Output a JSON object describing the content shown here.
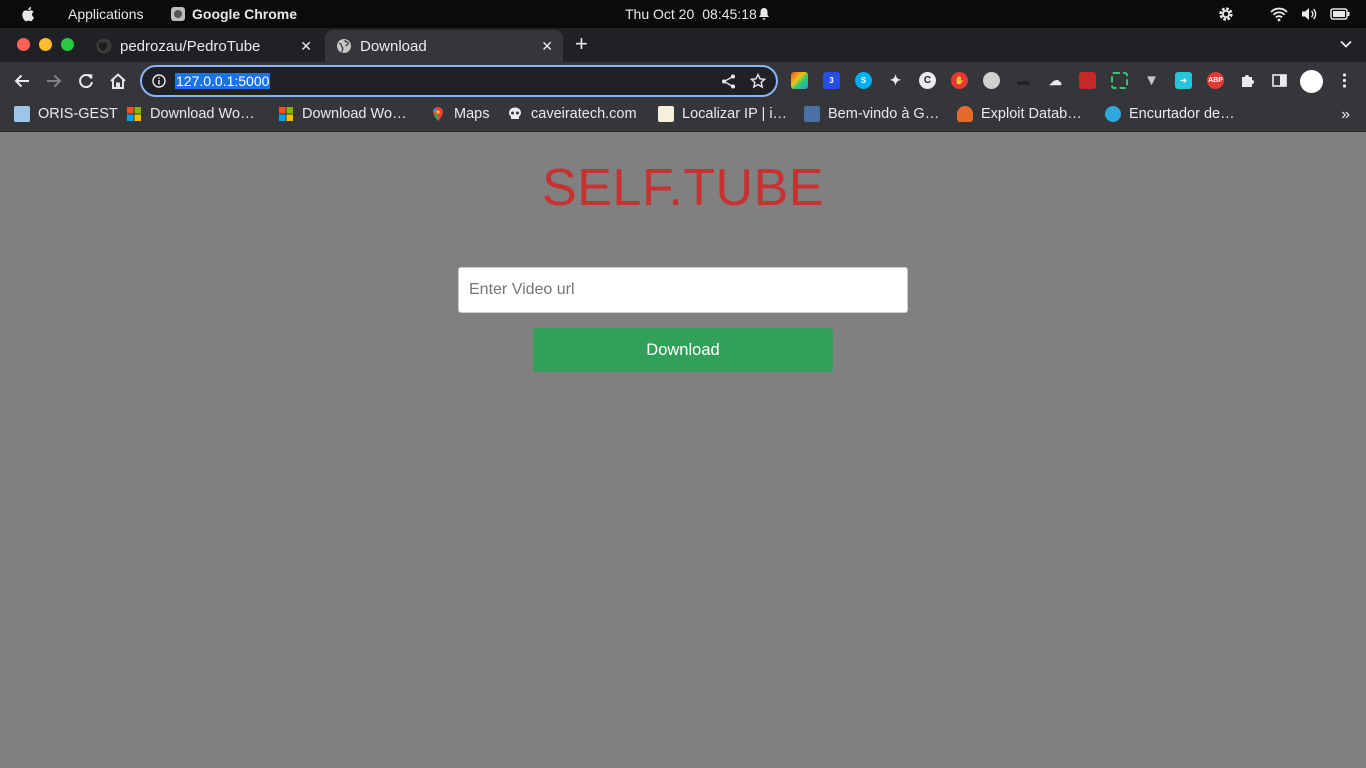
{
  "system_bar": {
    "applications_label": "Applications",
    "app_name": "Google Chrome",
    "date": "Thu Oct 20",
    "time": "08:45:18"
  },
  "browser": {
    "tabs": [
      {
        "title": "pedrozau/PedroTube",
        "icon": "github-icon",
        "active": false
      },
      {
        "title": "Download",
        "icon": "globe-icon",
        "active": true
      }
    ],
    "address": "127.0.0.1:5000",
    "bookmarks": [
      {
        "label": "ORIS-GEST",
        "icon": "book-icon"
      },
      {
        "label": "Download Wo…",
        "icon": "microsoft-icon"
      },
      {
        "label": "Download Wo…",
        "icon": "microsoft-icon"
      },
      {
        "label": "Maps",
        "icon": "maps-pin-icon"
      },
      {
        "label": "caveiratech.com",
        "icon": "skull-icon"
      },
      {
        "label": "Localizar IP | i…",
        "icon": "notepad-icon"
      },
      {
        "label": "Bem-vindo à G…",
        "icon": "building-icon"
      },
      {
        "label": "Exploit Datab…",
        "icon": "bug-icon"
      },
      {
        "label": "Encurtador de…",
        "icon": "link-icon"
      }
    ],
    "extensions": [
      "cube-icon",
      "css-icon",
      "skype-icon",
      "cat-icon",
      "c-icon",
      "hand-stop-icon",
      "helmet-icon",
      "hat-icon",
      "cloud-icon",
      "grid-red-icon",
      "screenshot-icon",
      "v-icon",
      "arrow-box-icon",
      "abp-icon",
      "puzzle-icon",
      "sidepanel-icon",
      "profile-avatar",
      "kebab-menu-icon"
    ],
    "abp_label": "ABP"
  },
  "page": {
    "title": "SELF.TUBE",
    "input_placeholder": "Enter Video url",
    "input_value": "",
    "button_label": "Download"
  },
  "colors": {
    "page_background": "#808080",
    "title": "#c8312f",
    "button": "#33a05a"
  }
}
